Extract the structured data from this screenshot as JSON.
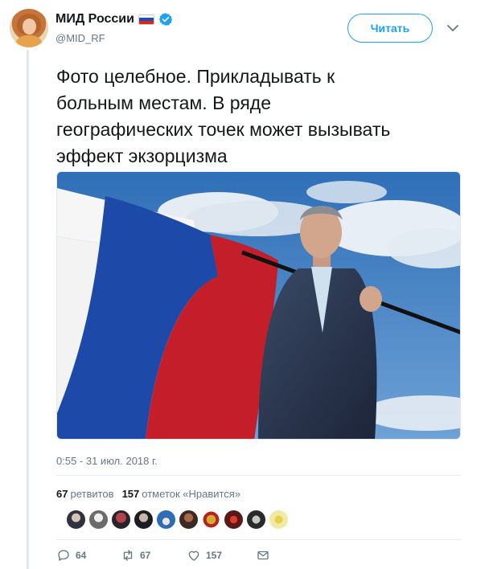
{
  "header": {
    "display_name": "МИД России",
    "handle": "@MID_RF",
    "follow_label": "Читать",
    "flag_colors": [
      "#ffffff",
      "#1e4fb3",
      "#d52b1e"
    ],
    "verified_color": "#1da1f2"
  },
  "tweet": {
    "text_lines": [
      "Фото целебное. Прикладывать к",
      "больным местам. В ряде",
      "географических точек может вызывать",
      "эффект экзорцизма"
    ],
    "timestamp": "0:55 - 31 июл. 2018 г."
  },
  "stats": {
    "retweets_count": "67",
    "retweets_label": "ретвитов",
    "likes_count": "157",
    "likes_label": "отметок «Нравится»"
  },
  "likers_count_shown": 10,
  "actions": {
    "reply_count": "64",
    "retweet_count": "67",
    "like_count": "157"
  },
  "colors": {
    "accent": "#1da1f2",
    "muted": "#657786",
    "sky": "#3e7bbd"
  }
}
